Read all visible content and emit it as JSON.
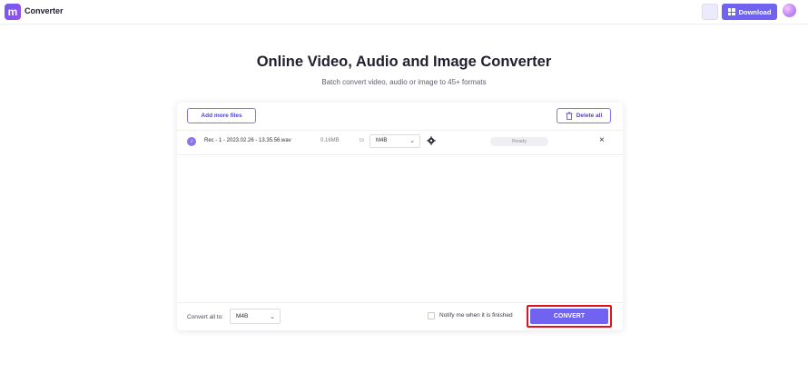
{
  "app": {
    "brand": "Converter",
    "logo_letter": "m",
    "download_label": "Download"
  },
  "hero": {
    "title": "Online Video, Audio and Image Converter",
    "subtitle": "Batch convert video, audio or image to 45+ formats"
  },
  "toolbar": {
    "add_more_label": "Add more files",
    "delete_all_label": "Delete all"
  },
  "files": [
    {
      "name": "Rec - 1 - 2023.02.26 - 13.35.56.wav",
      "size": "0.16MB",
      "to_label": "to",
      "format": "M4B",
      "status": "Ready"
    }
  ],
  "footer": {
    "convert_all_label": "Convert all to:",
    "convert_all_format": "M4B",
    "notify_label": "Notify me when it is finished",
    "convert_label": "CONVERT"
  },
  "colors": {
    "accent": "#6f63ef",
    "highlight": "#e3131e"
  }
}
